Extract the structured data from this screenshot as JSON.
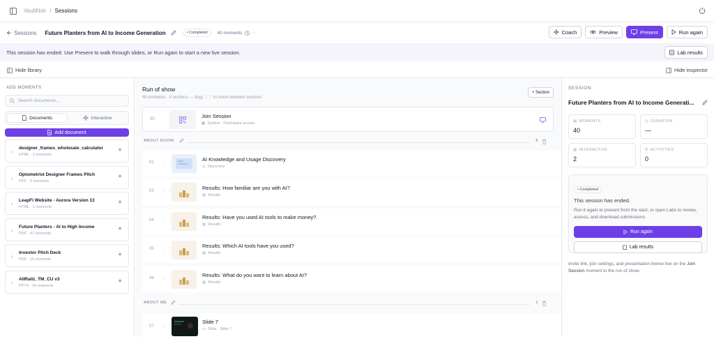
{
  "breadcrumb": {
    "app": "VaultNoir",
    "sep": "/",
    "page": "Sessions"
  },
  "header": {
    "back_label": "Sessions",
    "title": "Future Planters from AI to Income Generation",
    "status_badge": "• Completed",
    "moments_count": "40 moments",
    "more": "···"
  },
  "actions": {
    "coach": "Coach",
    "preview": "Preview",
    "present": "Present",
    "run_again": "Run again"
  },
  "notice": {
    "text": "This session has ended. Use Present to walk through slides, or Run again to start a new live session.",
    "lab_results": "Lab results"
  },
  "toolbar": {
    "hide_library": "Hide library",
    "hide_inspector": "Hide inspector"
  },
  "library": {
    "section_label": "ADD MOMENTS",
    "search_placeholder": "Search documents...",
    "tabs": [
      "Documents",
      "Interactive"
    ],
    "add_document": "Add document",
    "docs": [
      {
        "name": "designer_frames_wholesale_calculator",
        "sub": "HTML · 1 moments"
      },
      {
        "name": "Optometrist Designer Frames Pitch",
        "sub": "PDF · 6 moments"
      },
      {
        "name": "LeapFi Website - Aurora Version 13",
        "sub": "HTML · 1 moments"
      },
      {
        "name": "Future Planters - AI to High Income",
        "sub": "PDF · 47 moments"
      },
      {
        "name": "Investor Pitch Deck",
        "sub": "PDF · 15 moments"
      },
      {
        "name": "AllRailz_TM_CU v3",
        "sub": "PPTX · 24 moments"
      }
    ]
  },
  "run_of_show": {
    "title": "Run of show",
    "sub": "40 moments · 8 sections — drag ⋮⋮ to move between sections",
    "section_btn": "+ Section",
    "join": {
      "num": "00",
      "title": "Join Session",
      "sub": "System · Participant access"
    },
    "groups": [
      {
        "name": "ABOUT ROOM",
        "count": "5"
      },
      {
        "name": "ABOUT ME",
        "count": "1"
      }
    ],
    "items": [
      {
        "num": "02",
        "title": "AI Knowledge and Usage Discovery",
        "sub": "Discovery"
      },
      {
        "num": "03",
        "title": "Results: How familiar are you with AI?",
        "sub": "Results"
      },
      {
        "num": "04",
        "title": "Results: Have you used AI tools to make money?",
        "sub": "Results"
      },
      {
        "num": "05",
        "title": "Results: Which AI tools have you used?",
        "sub": "Results"
      },
      {
        "num": "06",
        "title": "Results: What do you want to learn about AI?",
        "sub": "Results"
      },
      {
        "num": "07",
        "title": "Slide 7",
        "sub": "Slide · Slide 7"
      }
    ]
  },
  "inspector": {
    "label": "SESSION",
    "title": "Future Planters from AI to Income Generati...",
    "stats": [
      {
        "label": "MOMENTS",
        "value": "40"
      },
      {
        "label": "DURATION",
        "value": "—"
      },
      {
        "label": "INTERACTIVE",
        "value": "2"
      },
      {
        "label": "ACTIVITIES",
        "value": "0"
      }
    ],
    "completed_badge": "• Completed",
    "ended": "This session has ended.",
    "ended_desc": "Run it again to present from the start, or open Labs to review, assess, and download submissions.",
    "run_again": "Run again",
    "lab_results": "Lab results",
    "footnote_a": "Invite link, join settings, and presentation theme live on the",
    "footnote_b": "Join Session",
    "footnote_c": "moment in the run of show."
  },
  "colors": {
    "accent": "#6d3fe6",
    "notice_bg": "#f5f3fb"
  }
}
